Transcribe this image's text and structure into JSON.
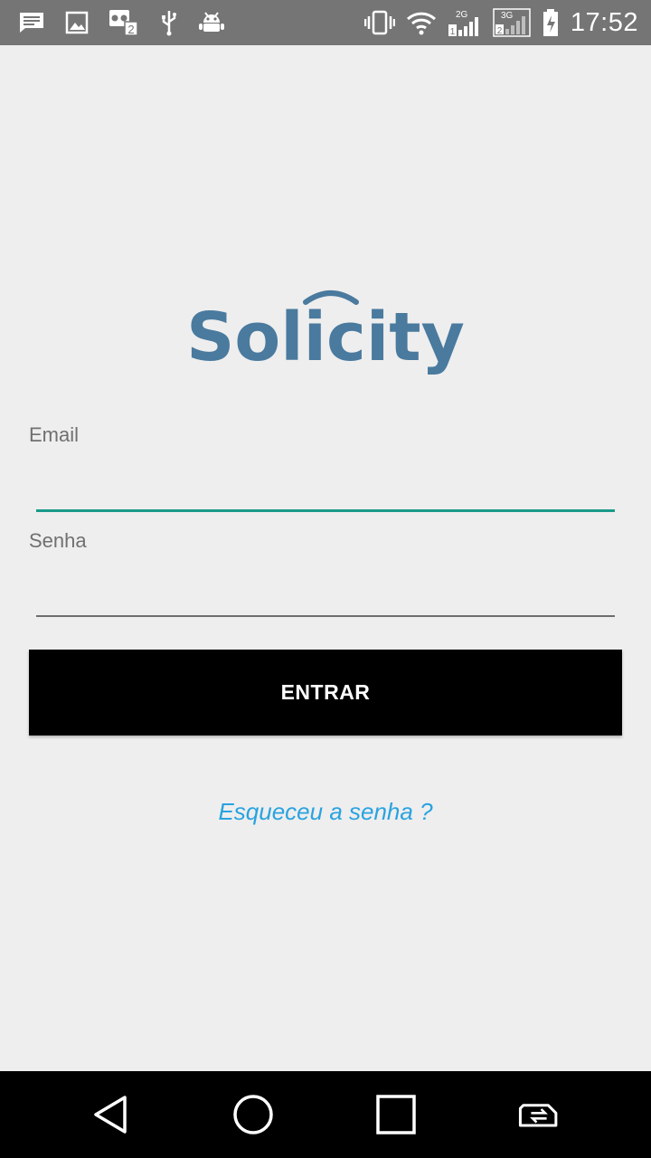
{
  "status_bar": {
    "time": "17:52",
    "left_icons": [
      "message-icon",
      "image-icon",
      "voicemail-sim2-icon",
      "usb-icon",
      "android-debug-icon"
    ],
    "right_icons": [
      "vibrate-icon",
      "wifi-icon",
      "signal-2g-sim1-icon",
      "signal-3g-sim2-icon",
      "battery-charging-icon"
    ],
    "sim1_label": "1",
    "sim2_label": "2",
    "net1_label": "2G",
    "net2_label": "3G"
  },
  "logo": {
    "text": "Solicity",
    "color": "#4a7a9e"
  },
  "form": {
    "email_label": "Email",
    "email_value": "",
    "senha_label": "Senha",
    "senha_value": "",
    "submit_label": "ENTRAR",
    "forgot_label": "Esqueceu a senha ?"
  },
  "colors": {
    "accent": "#1a9a8a",
    "link": "#29a3e0",
    "button_bg": "#000000",
    "background": "#eeeeee"
  },
  "nav_bar": {
    "buttons": [
      "back-icon",
      "home-icon",
      "recent-apps-icon",
      "sim-switch-icon"
    ]
  }
}
